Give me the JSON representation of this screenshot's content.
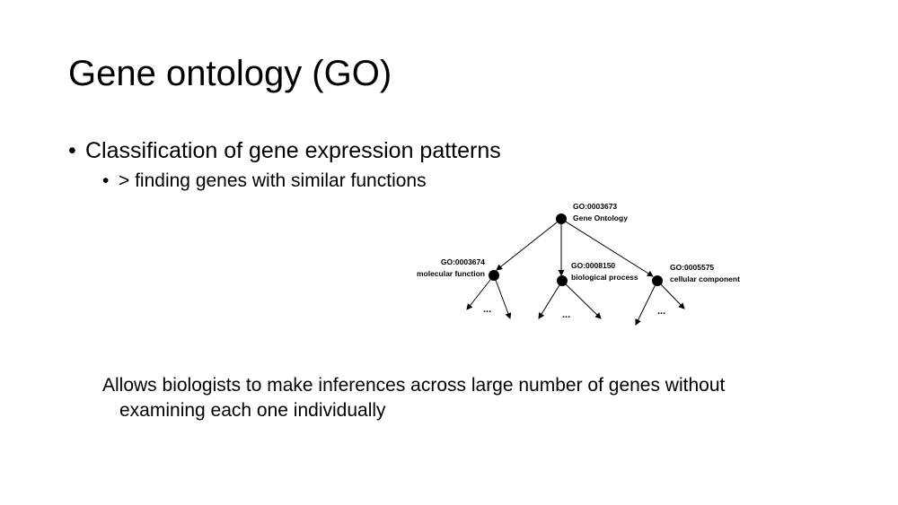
{
  "slide": {
    "title": "Gene ontology (GO)",
    "bullets": [
      {
        "marker": "•",
        "text": "Classification of gene expression patterns"
      },
      {
        "marker": "•",
        "text": "> finding genes with similar functions"
      }
    ],
    "paragraph": {
      "line1": "Allows biologists to make inferences across large number of genes without",
      "line2": "examining each one individually"
    }
  },
  "diagram": {
    "root": {
      "id": "GO:0003673",
      "label": "Gene Ontology"
    },
    "children": [
      {
        "id": "GO:0003674",
        "label": "molecular function",
        "more": "..."
      },
      {
        "id": "GO:0008150",
        "label": "biological process",
        "more": "..."
      },
      {
        "id": "GO:0005575",
        "label": "cellular component",
        "more": "..."
      }
    ],
    "colors": {
      "node": "#000000",
      "edge": "#000000",
      "background": "#ffffff"
    }
  }
}
